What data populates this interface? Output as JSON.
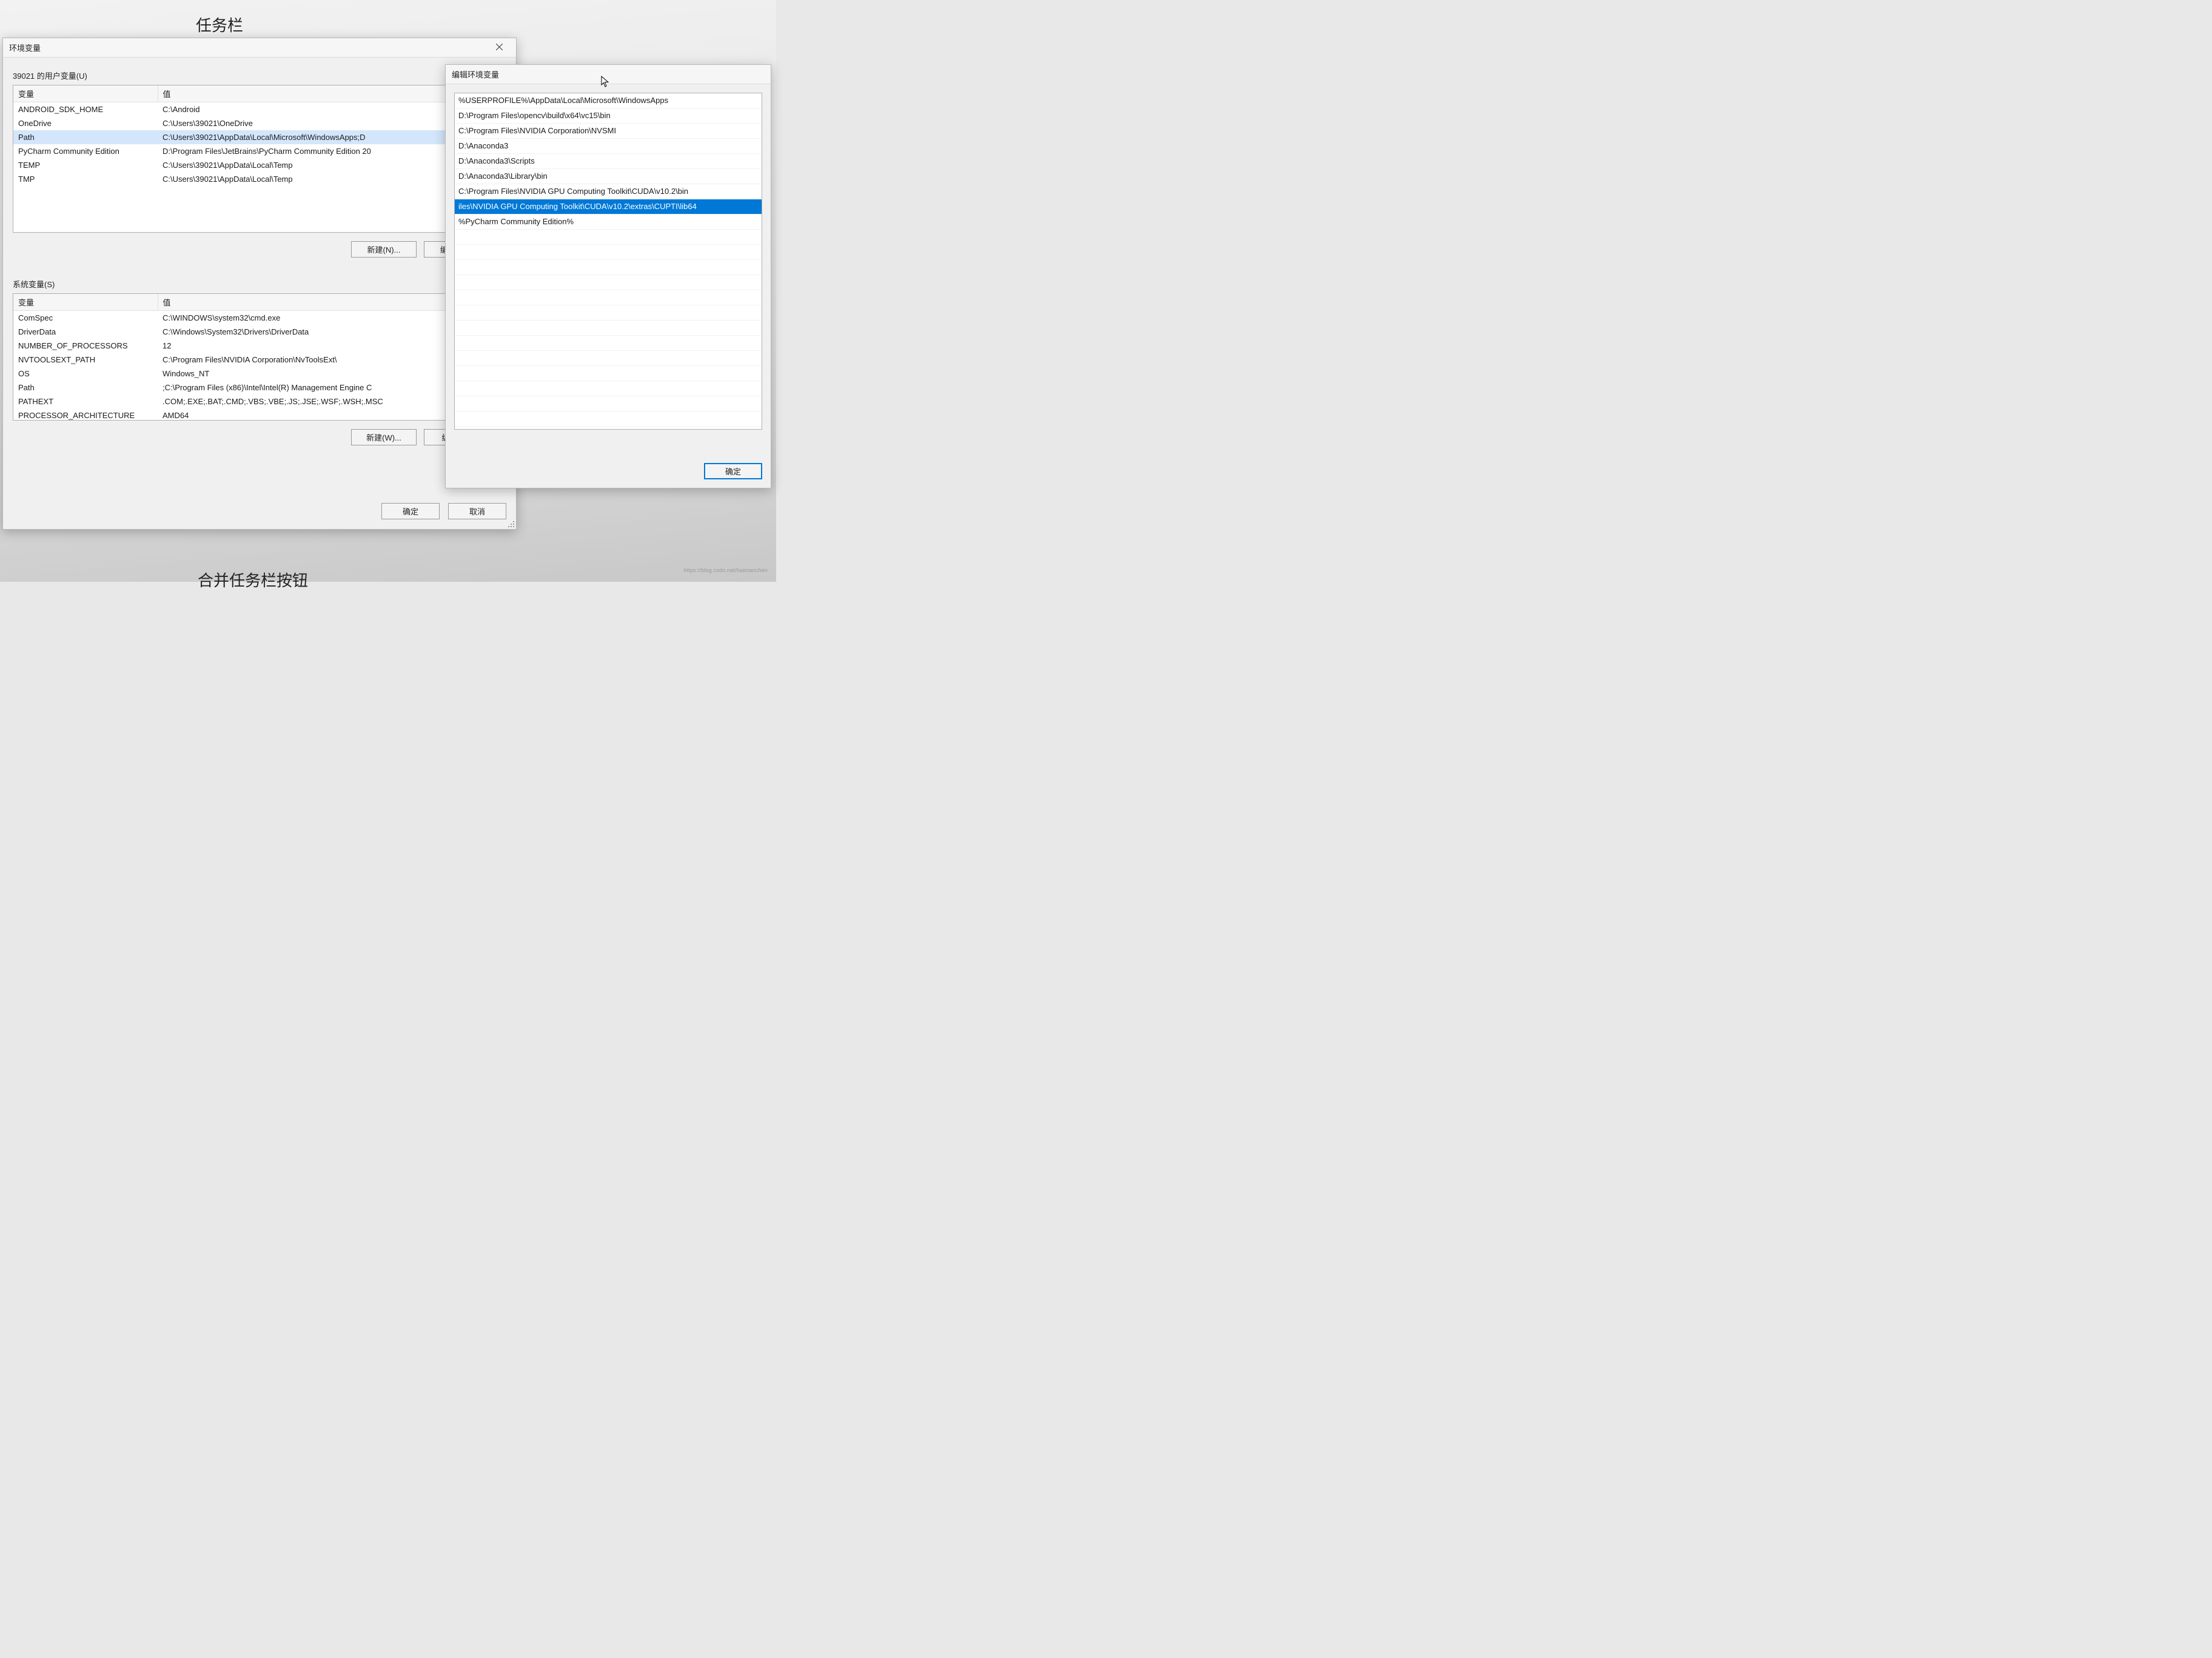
{
  "background": {
    "heading_top": "任务栏",
    "heading_bottom": "合并任务栏按钮",
    "watermark": "https://blog.csdn.net/haimanchen"
  },
  "env_window": {
    "title": "环境变量",
    "user_section_label": "39021 的用户变量(U)",
    "system_section_label": "系统变量(S)",
    "headers": {
      "var": "变量",
      "val": "值"
    },
    "user_vars": [
      {
        "name": "ANDROID_SDK_HOME",
        "value": "C:\\Android"
      },
      {
        "name": "OneDrive",
        "value": "C:\\Users\\39021\\OneDrive"
      },
      {
        "name": "Path",
        "value": "C:\\Users\\39021\\AppData\\Local\\Microsoft\\WindowsApps;D",
        "selected": true
      },
      {
        "name": "PyCharm Community Edition",
        "value": "D:\\Program Files\\JetBrains\\PyCharm Community Edition 20"
      },
      {
        "name": "TEMP",
        "value": "C:\\Users\\39021\\AppData\\Local\\Temp"
      },
      {
        "name": "TMP",
        "value": "C:\\Users\\39021\\AppData\\Local\\Temp"
      }
    ],
    "system_vars": [
      {
        "name": "ComSpec",
        "value": "C:\\WINDOWS\\system32\\cmd.exe"
      },
      {
        "name": "DriverData",
        "value": "C:\\Windows\\System32\\Drivers\\DriverData"
      },
      {
        "name": "NUMBER_OF_PROCESSORS",
        "value": "12"
      },
      {
        "name": "NVTOOLSEXT_PATH",
        "value": "C:\\Program Files\\NVIDIA Corporation\\NvToolsExt\\"
      },
      {
        "name": "OS",
        "value": "Windows_NT"
      },
      {
        "name": "Path",
        "value": ";C:\\Program Files (x86)\\Intel\\Intel(R) Management Engine C"
      },
      {
        "name": "PATHEXT",
        "value": ".COM;.EXE;.BAT;.CMD;.VBS;.VBE;.JS;.JSE;.WSF;.WSH;.MSC"
      },
      {
        "name": "PROCESSOR_ARCHITECTURE",
        "value": "AMD64"
      }
    ],
    "buttons": {
      "new_user": "新建(N)...",
      "edit_user": "编辑(E)...",
      "new_sys": "新建(W)...",
      "edit_sys": "编辑(I)...",
      "ok": "确定",
      "cancel": "取消"
    }
  },
  "edit_window": {
    "title": "编辑环境变量",
    "entries": [
      {
        "text": "%USERPROFILE%\\AppData\\Local\\Microsoft\\WindowsApps"
      },
      {
        "text": "D:\\Program Files\\opencv\\build\\x64\\vc15\\bin"
      },
      {
        "text": "C:\\Program Files\\NVIDIA Corporation\\NVSMI"
      },
      {
        "text": "D:\\Anaconda3"
      },
      {
        "text": "D:\\Anaconda3\\Scripts"
      },
      {
        "text": "D:\\Anaconda3\\Library\\bin"
      },
      {
        "text": "C:\\Program Files\\NVIDIA GPU Computing Toolkit\\CUDA\\v10.2\\bin"
      },
      {
        "text": "iles\\NVIDIA GPU Computing Toolkit\\CUDA\\v10.2\\extras\\CUPTI\\lib64",
        "selected": true
      },
      {
        "text": "%PyCharm Community Edition%"
      }
    ],
    "buttons": {
      "ok": "确定"
    }
  }
}
